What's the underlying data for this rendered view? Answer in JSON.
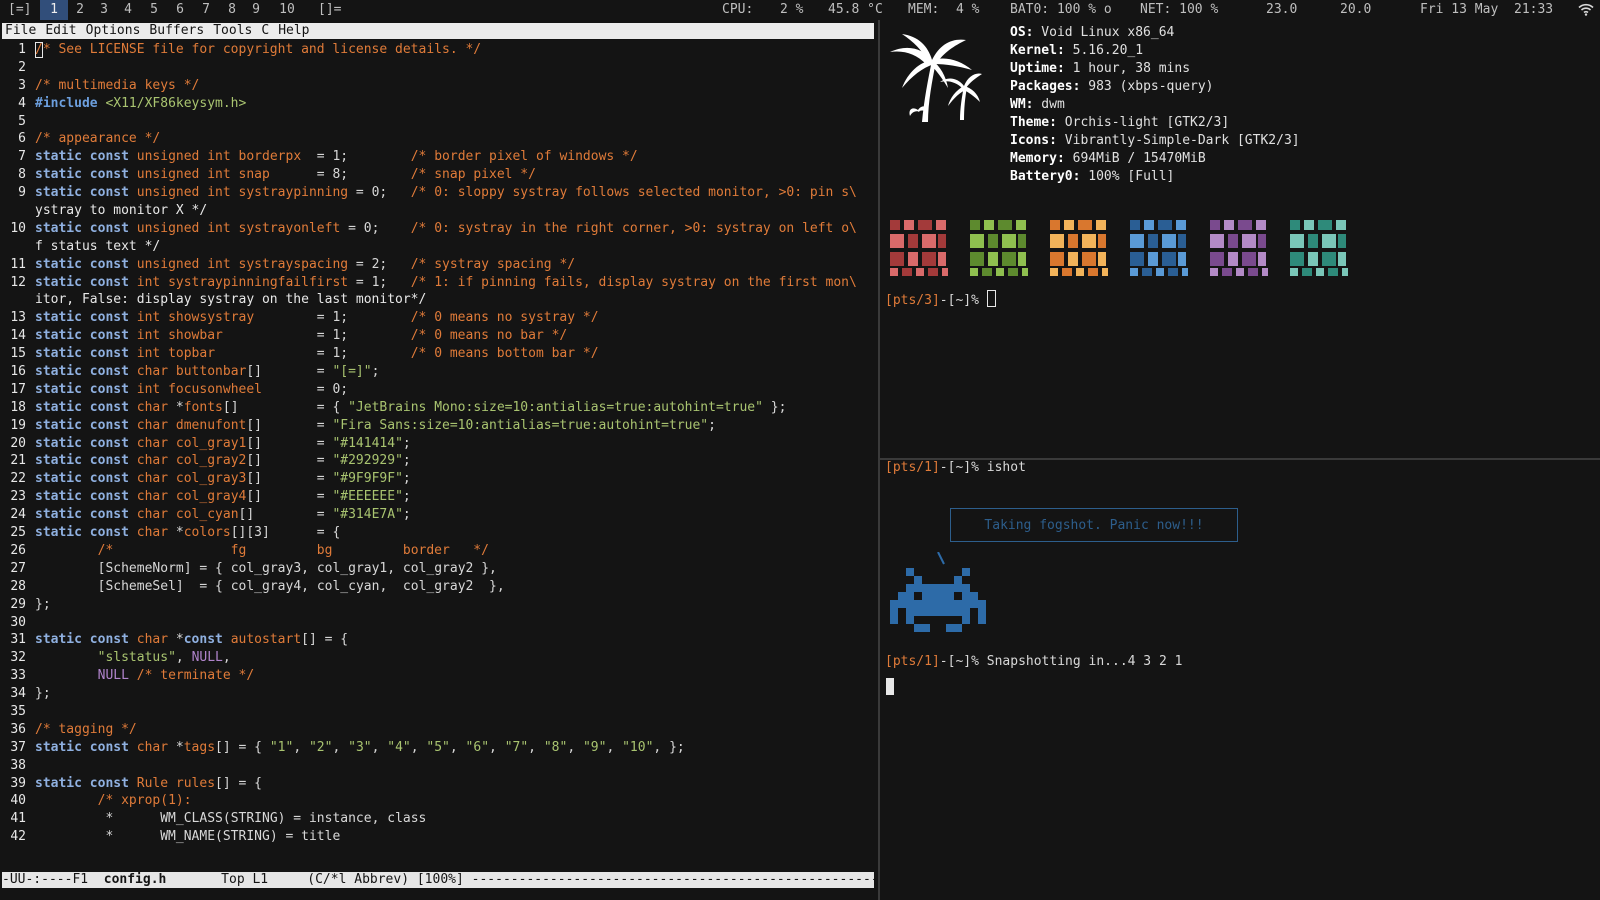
{
  "bar": {
    "layout_symbol": "[=]",
    "tags": [
      "1",
      "2",
      "3",
      "4",
      "5",
      "6",
      "7",
      "8",
      "9",
      "10"
    ],
    "selected_tag": "1",
    "layout_symbol2": "[]=",
    "cpu_label": "CPU:",
    "cpu_value": "2 %",
    "temp": "45.8 °C",
    "mem_label": "MEM:",
    "mem_value": "4 %",
    "bat": "BAT0: 100 % o",
    "net": "NET: 100 %",
    "num1": "23.0",
    "num2": "20.0",
    "date": "Fri 13 May",
    "time": "21:33",
    "wifi_icon": "wifi-icon"
  },
  "emacs": {
    "menu": [
      "File",
      "Edit",
      "Options",
      "Buffers",
      "Tools",
      "C",
      "Help"
    ],
    "modeline": {
      "status": "-UU-:----F1",
      "buffer": "config.h",
      "position": "Top L1",
      "mode": "(C/*l Abbrev) [100%]"
    },
    "lines": [
      {
        "n": "1",
        "t": "/* See LICENSE file for copyright and license details. */"
      },
      {
        "n": "2",
        "t": ""
      },
      {
        "n": "3",
        "t": "/* multimedia keys */"
      },
      {
        "n": "4",
        "t": "#include <X11/XF86keysym.h>"
      },
      {
        "n": "5",
        "t": ""
      },
      {
        "n": "6",
        "t": "/* appearance */"
      },
      {
        "n": "7",
        "t": "static const unsigned int borderpx  = 1;        /* border pixel of windows */"
      },
      {
        "n": "8",
        "t": "static const unsigned int snap      = 8;        /* snap pixel */"
      },
      {
        "n": "9",
        "t": "static const unsigned int systraypinning = 0;   /* 0: sloppy systray follows selected monitor, >0: pin s\\"
      },
      {
        "n": "",
        "t": "ystray to monitor X */"
      },
      {
        "n": "10",
        "t": "static const unsigned int systrayonleft = 0;    /* 0: systray in the right corner, >0: systray on left o\\"
      },
      {
        "n": "",
        "t": "f status text */"
      },
      {
        "n": "11",
        "t": "static const unsigned int systrayspacing = 2;   /* systray spacing */"
      },
      {
        "n": "12",
        "t": "static const int systraypinningfailfirst = 1;   /* 1: if pinning fails, display systray on the first mon\\"
      },
      {
        "n": "",
        "t": "itor, False: display systray on the last monitor*/"
      },
      {
        "n": "13",
        "t": "static const int showsystray        = 1;        /* 0 means no systray */"
      },
      {
        "n": "14",
        "t": "static const int showbar            = 1;        /* 0 means no bar */"
      },
      {
        "n": "15",
        "t": "static const int topbar             = 1;        /* 0 means bottom bar */"
      },
      {
        "n": "16",
        "t": "static const char buttonbar[]       = \"[=]\";"
      },
      {
        "n": "17",
        "t": "static const int focusonwheel       = 0;"
      },
      {
        "n": "18",
        "t": "static const char *fonts[]          = { \"JetBrains Mono:size=10:antialias=true:autohint=true\" };"
      },
      {
        "n": "19",
        "t": "static const char dmenufont[]       = \"Fira Sans:size=10:antialias=true:autohint=true\";"
      },
      {
        "n": "20",
        "t": "static const char col_gray1[]       = \"#141414\";"
      },
      {
        "n": "21",
        "t": "static const char col_gray2[]       = \"#292929\";"
      },
      {
        "n": "22",
        "t": "static const char col_gray3[]       = \"#9F9F9F\";"
      },
      {
        "n": "23",
        "t": "static const char col_gray4[]       = \"#EEEEEE\";"
      },
      {
        "n": "24",
        "t": "static const char col_cyan[]        = \"#314E7A\";"
      },
      {
        "n": "25",
        "t": "static const char *colors[][3]      = {"
      },
      {
        "n": "26",
        "t": "        /*               fg         bg         border   */"
      },
      {
        "n": "27",
        "t": "        [SchemeNorm] = { col_gray3, col_gray1, col_gray2 },"
      },
      {
        "n": "28",
        "t": "        [SchemeSel]  = { col_gray4, col_cyan,  col_gray2  },"
      },
      {
        "n": "29",
        "t": "};"
      },
      {
        "n": "30",
        "t": ""
      },
      {
        "n": "31",
        "t": "static const char *const autostart[] = {"
      },
      {
        "n": "32",
        "t": "        \"slstatus\", NULL,"
      },
      {
        "n": "33",
        "t": "        NULL /* terminate */"
      },
      {
        "n": "34",
        "t": "};"
      },
      {
        "n": "35",
        "t": ""
      },
      {
        "n": "36",
        "t": "/* tagging */"
      },
      {
        "n": "37",
        "t": "static const char *tags[] = { \"1\", \"2\", \"3\", \"4\", \"5\", \"6\", \"7\", \"8\", \"9\", \"10\", };"
      },
      {
        "n": "38",
        "t": ""
      },
      {
        "n": "39",
        "t": "static const Rule rules[] = {"
      },
      {
        "n": "40",
        "t": "        /* xprop(1):"
      },
      {
        "n": "41",
        "t": "         *      WM_CLASS(STRING) = instance, class"
      },
      {
        "n": "42",
        "t": "         *      WM_NAME(STRING) = title"
      }
    ]
  },
  "term1": {
    "logo_icon": "palm-trees-icon",
    "info": [
      {
        "key": "OS:",
        "val": " Void Linux x86_64"
      },
      {
        "key": "Kernel:",
        "val": " 5.16.20_1"
      },
      {
        "key": "Uptime:",
        "val": " 1 hour, 38 mins"
      },
      {
        "key": "Packages:",
        "val": " 983 (xbps-query)"
      },
      {
        "key": "WM:",
        "val": " dwm"
      },
      {
        "key": "Theme:",
        "val": " Orchis-light [GTK2/3]"
      },
      {
        "key": "Icons:",
        "val": " Vibrantly-Simple-Dark [GTK2/3]"
      },
      {
        "key": "Memory:",
        "val": " 694MiB / 15470MiB"
      },
      {
        "key": "Battery0:",
        "val": " 100% [Full]"
      }
    ],
    "color_blocks": [
      {
        "dark": "#a33a3a",
        "light": "#d96a6a"
      },
      {
        "dark": "#5d8a2e",
        "light": "#8fbf4f"
      },
      {
        "dark": "#d9772e",
        "light": "#f2b35a"
      },
      {
        "dark": "#2a5e94",
        "light": "#5a9ad6"
      },
      {
        "dark": "#7a4a8e",
        "light": "#b38ac6"
      },
      {
        "dark": "#2e8a7a",
        "light": "#7ac6b8"
      }
    ],
    "prompt_tty": "[pts/3]",
    "prompt_rest": "-[~]% "
  },
  "term2": {
    "prompt1_tty": "[pts/1]",
    "prompt1_rest": "-[~]% ",
    "cmd1": "ishot",
    "bubble": "Taking fogshot. Panic now!!!",
    "invader_icon": "space-invader-icon",
    "prompt2_tty": "[pts/1]",
    "prompt2_rest": "-[~]% ",
    "cmd2": "Snapshotting in...4 3 2 1"
  }
}
